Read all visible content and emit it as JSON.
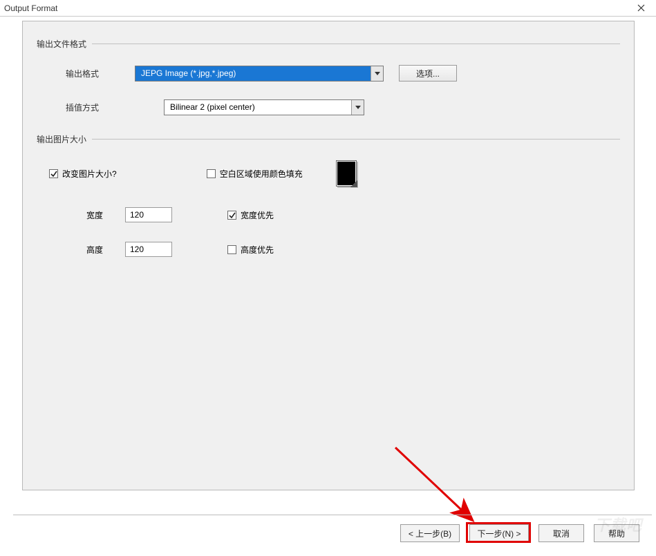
{
  "window": {
    "title": "Output Format"
  },
  "group_format": {
    "title": "输出文件格式",
    "output_format_label": "输出格式",
    "output_format_value": "JEPG Image (*.jpg,*.jpeg)",
    "options_button": "选项...",
    "interp_label": "插值方式",
    "interp_value": "Bilinear 2 (pixel center)"
  },
  "group_size": {
    "title": "输出图片大小",
    "resize_label": "改变图片大小?",
    "resize_checked": true,
    "fill_label": "空白区域使用颜色填充",
    "fill_checked": false,
    "fill_color": "#000000",
    "width_label": "宽度",
    "width_value": "120",
    "width_priority_label": "宽度优先",
    "width_priority_checked": true,
    "height_label": "高度",
    "height_value": "120",
    "height_priority_label": "高度优先",
    "height_priority_checked": false
  },
  "wizard": {
    "back": "< 上一步(B)",
    "next": "下一步(N) >",
    "cancel": "取消",
    "help": "帮助"
  },
  "watermark": "下载吧"
}
